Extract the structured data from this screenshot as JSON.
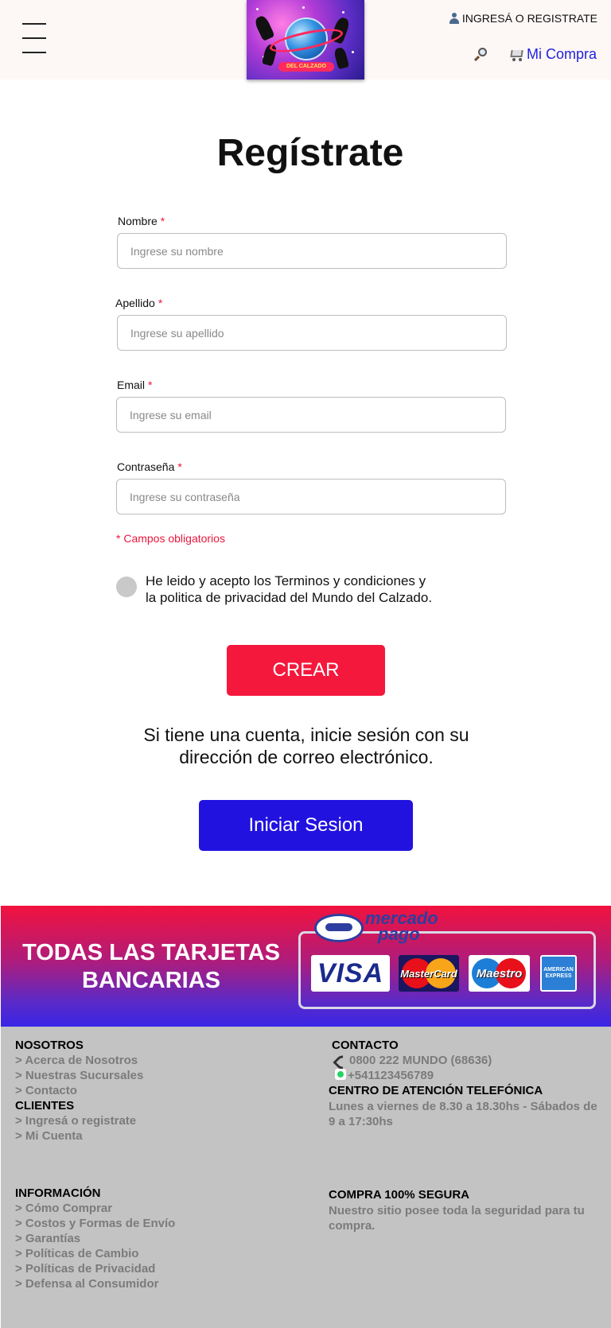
{
  "header": {
    "logo_alt": "Mundo del Calzado",
    "logo_banner": "DEL CALZADO",
    "login_label": "INGRESÁ O REGISTRATE",
    "cart_label": "Mi Compra"
  },
  "form": {
    "title": "Regístrate",
    "fields": [
      {
        "label": "Nombre",
        "placeholder": "Ingrese su nombre"
      },
      {
        "label": "Apellido",
        "placeholder": "Ingrese su apellido"
      },
      {
        "label": "Email",
        "placeholder": "Ingrese su email"
      },
      {
        "label": "Contraseña",
        "placeholder": "Ingrese su contraseña"
      }
    ],
    "required_mark": "*",
    "required_note": "* Campos obligatorios",
    "terms_line1": "He leido y acepto los Terminos y condiciones  y",
    "terms_line2": "la politica de privacidad del Mundo del Calzado.",
    "create_label": "CREAR",
    "has_account_text": "Si tiene una cuenta, inicie sesión con su dirección de correo electrónico.",
    "login_button_label": "Iniciar Sesion"
  },
  "banner": {
    "text": "TODAS LAS TARJETAS BANCARIAS",
    "mercadopago_line1": "mercado",
    "mercadopago_line2": "pago",
    "cards": {
      "visa": "VISA",
      "mastercard": "MasterCard",
      "maestro": "Maestro",
      "amex": "AMERICAN EXPRESS"
    }
  },
  "footer": {
    "nosotros": {
      "title": "NOSOTROS",
      "links": [
        "> Acerca de Nosotros",
        "> Nuestras Sucursales",
        "> Contacto"
      ]
    },
    "clientes": {
      "title": "CLIENTES",
      "links": [
        "> Ingresá o registrate",
        "> Mi Cuenta"
      ]
    },
    "informacion": {
      "title": "INFORMACIÓN",
      "links": [
        "> Cómo Comprar",
        "> Costos y Formas de Envío",
        "> Garantías",
        "> Políticas de Cambio",
        "> Políticas de Privacidad",
        "> Defensa al Consumidor"
      ]
    },
    "contacto": {
      "title": "CONTACTO",
      "phone": "0800 222 MUNDO (68636)",
      "whatsapp": "+541123456789"
    },
    "centro": {
      "title": "CENTRO DE ATENCIÓN TELEFÓNICA",
      "hours": "Lunes a viernes de 8.30 a 18.30hs - Sábados de 9 a 17:30hs"
    },
    "compra": {
      "title": "COMPRA 100% SEGURA",
      "text": "Nuestro sitio posee toda la seguridad para tu compra."
    }
  },
  "colors": {
    "header_bg": "#fdf7f6",
    "accent_red": "#f5183d",
    "accent_blue": "#2212e0",
    "link_blue": "#2222dd",
    "footer_bg": "#c3c3c3"
  }
}
